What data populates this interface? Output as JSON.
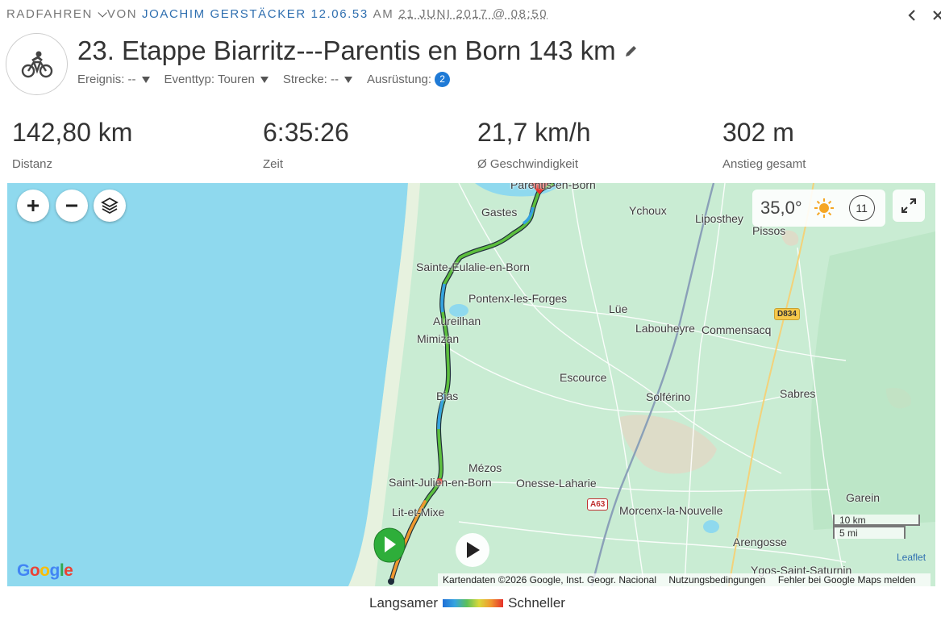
{
  "header": {
    "sport": "RADFAHREN",
    "von": "VON",
    "author": "JOACHIM GERSTÄCKER",
    "time": "12.06.53",
    "am": "AM",
    "date": "21 JUNI 2017 @ 08:50"
  },
  "activity": {
    "icon": "bicycle-icon",
    "title": "23. Etappe Biarritz---Parentis en Born 143 km",
    "meta": [
      {
        "label": "Ereignis: --"
      },
      {
        "label": "Eventtyp: Touren"
      },
      {
        "label": "Strecke: --"
      },
      {
        "label": "Ausrüstung:",
        "count": "2"
      }
    ]
  },
  "stats": [
    {
      "value": "142,80 km",
      "label": "Distanz"
    },
    {
      "value": "6:35:26",
      "label": "Zeit"
    },
    {
      "value": "21,7 km/h",
      "label": "Ø Geschwindigkeit"
    },
    {
      "value": "302 m",
      "label": "Anstieg gesamt"
    }
  ],
  "map": {
    "weather": {
      "temp": "35,0°",
      "wind": "11"
    },
    "places": [
      "Parentis-en-Born",
      "Gastes",
      "Ychoux",
      "Liposthey",
      "Pissos",
      "Sainte-Eulalie-en-Born",
      "Pontenx-les-Forges",
      "Lüe",
      "Aureilhan",
      "Labouheyre",
      "Commensacq",
      "Mimizan",
      "Escource",
      "Bias",
      "Solférino",
      "Sabres",
      "Mézos",
      "Saint-Julien-en-Born",
      "Onesse-Laharie",
      "Garein",
      "Lit-et-Mixe",
      "Morcenx-la-Nouvelle",
      "Arengosse",
      "Ygos-Saint-Saturnin"
    ],
    "roads": [
      "D834",
      "A63"
    ],
    "scale": {
      "km": "10 km",
      "mi": "5 mi"
    },
    "attribution": [
      "Kartendaten ©2026 Google, Inst. Geogr. Nacional",
      "Nutzungsbedingungen",
      "Fehler bei Google Maps melden"
    ],
    "leaflet": "Leaflet",
    "google": "Google",
    "colors": {
      "water": "#8fd9ee",
      "land": "#c9ecd3",
      "track": "#5cbf3e"
    }
  },
  "legend": {
    "slower": "Langsamer",
    "faster": "Schneller"
  }
}
